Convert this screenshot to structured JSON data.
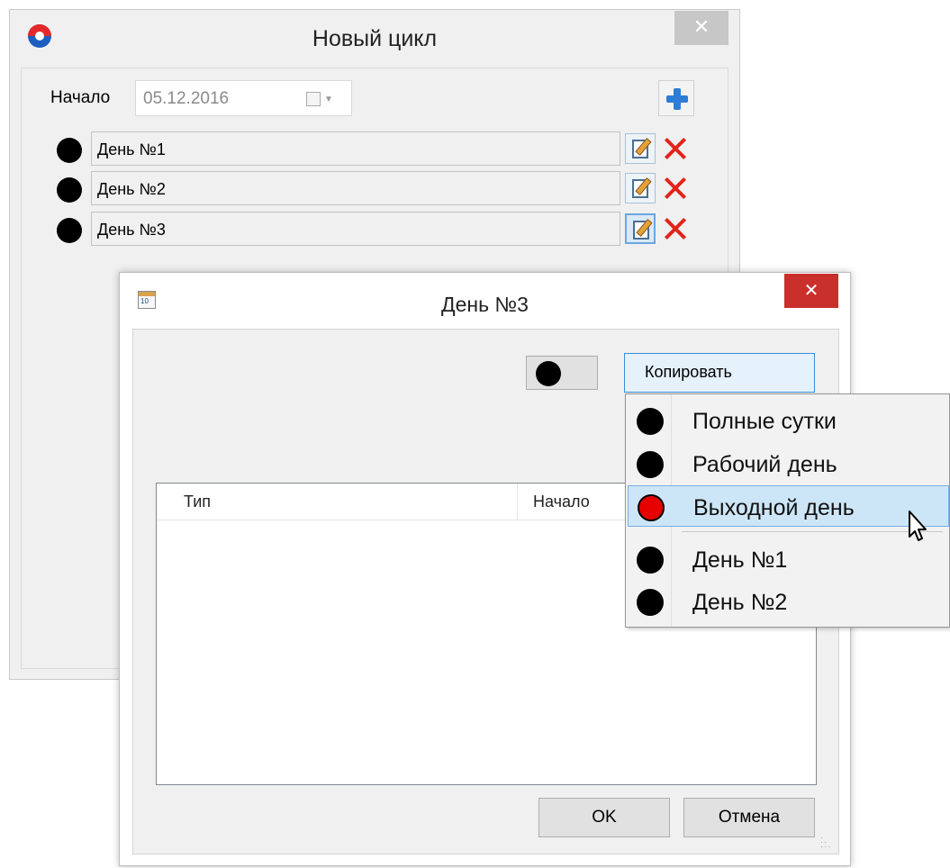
{
  "cycle_window": {
    "title": "Новый цикл",
    "close_glyph": "✕",
    "start_label": "Начало",
    "start_date": "05.12.2016",
    "icons": {
      "app": "app-logo-icon",
      "calendar": "calendar-dropdown-icon",
      "add": "plus-icon",
      "edit": "edit-document-icon",
      "delete": "red-x-delete-icon"
    },
    "days": [
      {
        "label": "День №1",
        "color": "#000000"
      },
      {
        "label": "День №2",
        "color": "#000000"
      },
      {
        "label": "День №3",
        "color": "#000000"
      }
    ]
  },
  "day_dialog": {
    "title": "День №3",
    "close_glyph": "✕",
    "calendar_icon_text": "10",
    "selected_color": "#000000",
    "copy_button": "Копировать",
    "table": {
      "columns": [
        "Тип",
        "Начало"
      ]
    },
    "ok_button": "OK",
    "cancel_button": "Отмена"
  },
  "copy_menu": {
    "items": [
      {
        "label": "Полные сутки",
        "color": "#000000"
      },
      {
        "label": "Рабочий день",
        "color": "#000000"
      },
      {
        "label": "Выходной день",
        "color": "#e60000",
        "highlighted": true
      },
      {
        "label": "День №1",
        "color": "#000000"
      },
      {
        "label": "День №2",
        "color": "#000000"
      }
    ]
  }
}
